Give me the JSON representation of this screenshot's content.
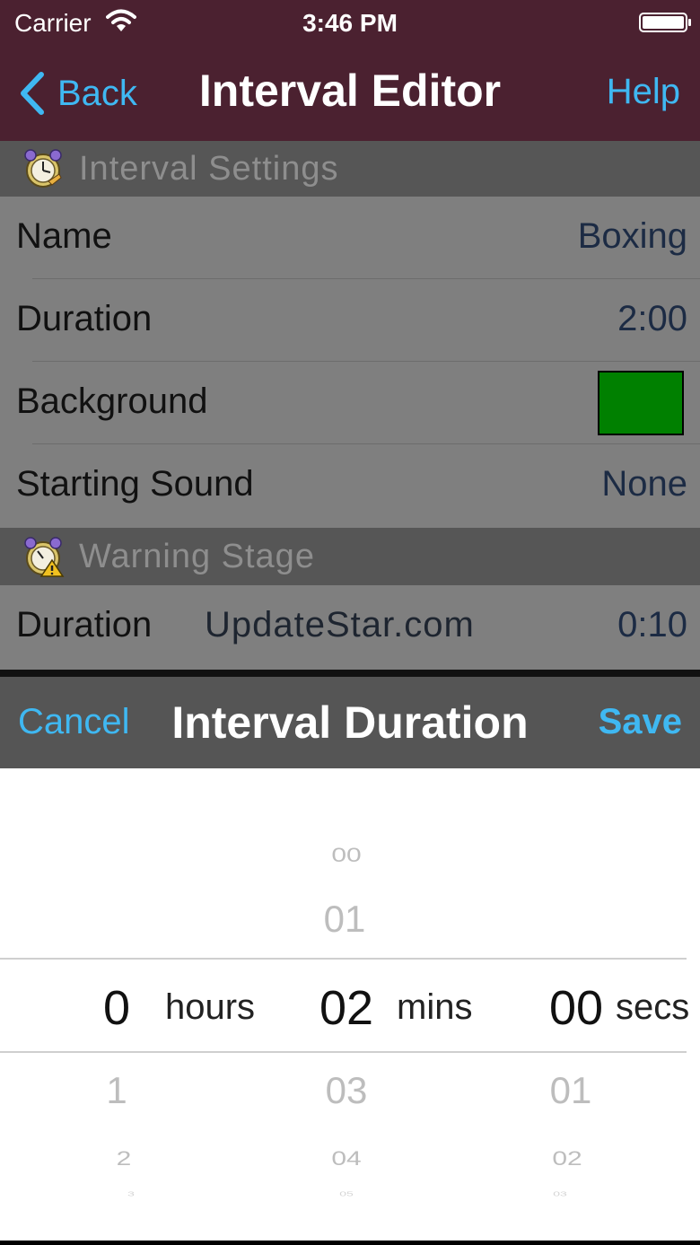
{
  "status_bar": {
    "carrier": "Carrier",
    "time": "3:46 PM"
  },
  "nav": {
    "back_label": "Back",
    "title": "Interval Editor",
    "help_label": "Help"
  },
  "sections": {
    "interval_settings": "Interval Settings",
    "warning_stage": "Warning Stage"
  },
  "settings": {
    "name_label": "Name",
    "name_value": "Boxing",
    "duration_label": "Duration",
    "duration_value": "2:00",
    "background_label": "Background",
    "background_color": "#008000",
    "sound_label": "Starting Sound",
    "sound_value": "None"
  },
  "warning": {
    "duration_label": "Duration",
    "duration_value": "0:10",
    "watermark": "UpdateStar.com"
  },
  "picker": {
    "cancel_label": "Cancel",
    "title": "Interval Duration",
    "save_label": "Save",
    "hours": {
      "above": [],
      "selected": "0",
      "below": [
        "1",
        "2",
        "3"
      ],
      "unit": "hours"
    },
    "mins": {
      "above": [
        "00",
        "01"
      ],
      "selected": "02",
      "below": [
        "03",
        "04",
        "05"
      ],
      "unit": "mins"
    },
    "secs": {
      "above": [],
      "selected": "00",
      "below": [
        "01",
        "02",
        "03"
      ],
      "unit": "secs"
    }
  },
  "colors": {
    "accent": "#3fb8f2",
    "nav_bar": "#4b2130",
    "background_swatch": "#008000"
  }
}
